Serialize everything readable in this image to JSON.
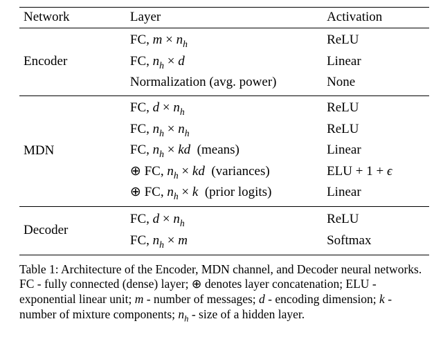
{
  "table": {
    "headers": {
      "network": "Network",
      "layer": "Layer",
      "activation": "Activation"
    },
    "groups": [
      {
        "name": "Encoder",
        "rows": [
          {
            "layer_html": "FC, <span class='ital'>m</span> × <span class='ital'>n<span class='sub'>h</span></span>",
            "activation": "ReLU"
          },
          {
            "layer_html": "FC, <span class='ital'>n<span class='sub'>h</span></span> × <span class='ital'>d</span>",
            "activation": "Linear"
          },
          {
            "layer_html": "Normalization (avg. power)",
            "activation": "None"
          }
        ]
      },
      {
        "name": "MDN",
        "rows": [
          {
            "layer_html": "FC, <span class='ital'>d</span> × <span class='ital'>n<span class='sub'>h</span></span>",
            "activation": "ReLU"
          },
          {
            "layer_html": "FC, <span class='ital'>n<span class='sub'>h</span></span> × <span class='ital'>n<span class='sub'>h</span></span>",
            "activation": "ReLU"
          },
          {
            "layer_html": "FC, <span class='ital'>n<span class='sub'>h</span></span> × <span class='ital'>kd</span>&nbsp;&nbsp;(means)",
            "activation": "Linear"
          },
          {
            "layer_html": "⊕ FC, <span class='ital'>n<span class='sub'>h</span></span> × <span class='ital'>kd</span>&nbsp;&nbsp;(variances)",
            "activation_html": "ELU + 1 + <span class='ital'>ϵ</span>"
          },
          {
            "layer_html": "⊕ FC, <span class='ital'>n<span class='sub'>h</span></span> × <span class='ital'>k</span>&nbsp;&nbsp;(prior logits)",
            "activation": "Linear"
          }
        ]
      },
      {
        "name": "Decoder",
        "rows": [
          {
            "layer_html": "FC, <span class='ital'>d</span> × <span class='ital'>n<span class='sub'>h</span></span>",
            "activation": "ReLU"
          },
          {
            "layer_html": "FC, <span class='ital'>n<span class='sub'>h</span></span> × <span class='ital'>m</span>",
            "activation": "Softmax"
          }
        ]
      }
    ]
  },
  "caption": {
    "label": "Table 1:",
    "text_html": "Architecture of the Encoder, MDN channel, and Decoder neural networks. FC - fully connected (dense) layer; ⊕ denotes layer concatenation; ELU - exponential linear unit; <span class='ital'>m</span> - number of messages; <span class='ital'>d</span> - encoding dimension; <span class='ital'>k</span> - number of mixture components; <span class='ital'>n<span class='sub'>h</span></span> - size of a hidden layer."
  }
}
